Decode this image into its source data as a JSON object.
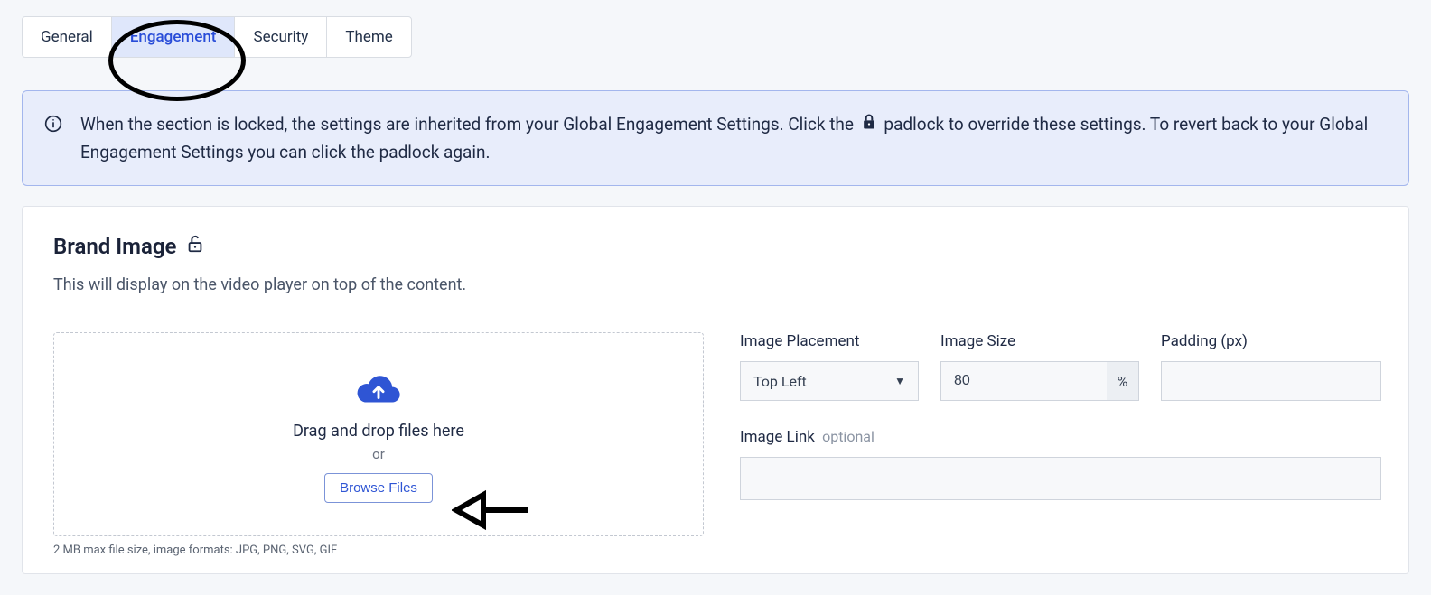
{
  "tabs": {
    "general": "General",
    "engagement": "Engagement",
    "security": "Security",
    "theme": "Theme"
  },
  "info": {
    "text_before_lock": "When the section is locked, the settings are inherited from your Global Engagement Settings. Click the",
    "text_after_lock": "padlock to override these settings. To revert back to your Global Engagement Settings you can click the padlock again."
  },
  "section": {
    "title": "Brand Image",
    "description": "This will display on the video player on top of the content."
  },
  "dropzone": {
    "main": "Drag and drop files here",
    "or": "or",
    "browse": "Browse Files",
    "hint": "2 MB max file size, image formats: JPG, PNG, SVG, GIF"
  },
  "fields": {
    "placement_label": "Image Placement",
    "placement_value": "Top Left",
    "size_label": "Image Size",
    "size_value": "80",
    "size_unit": "%",
    "padding_label": "Padding (px)",
    "padding_value": "",
    "link_label": "Image Link",
    "link_optional": "optional",
    "link_value": ""
  }
}
